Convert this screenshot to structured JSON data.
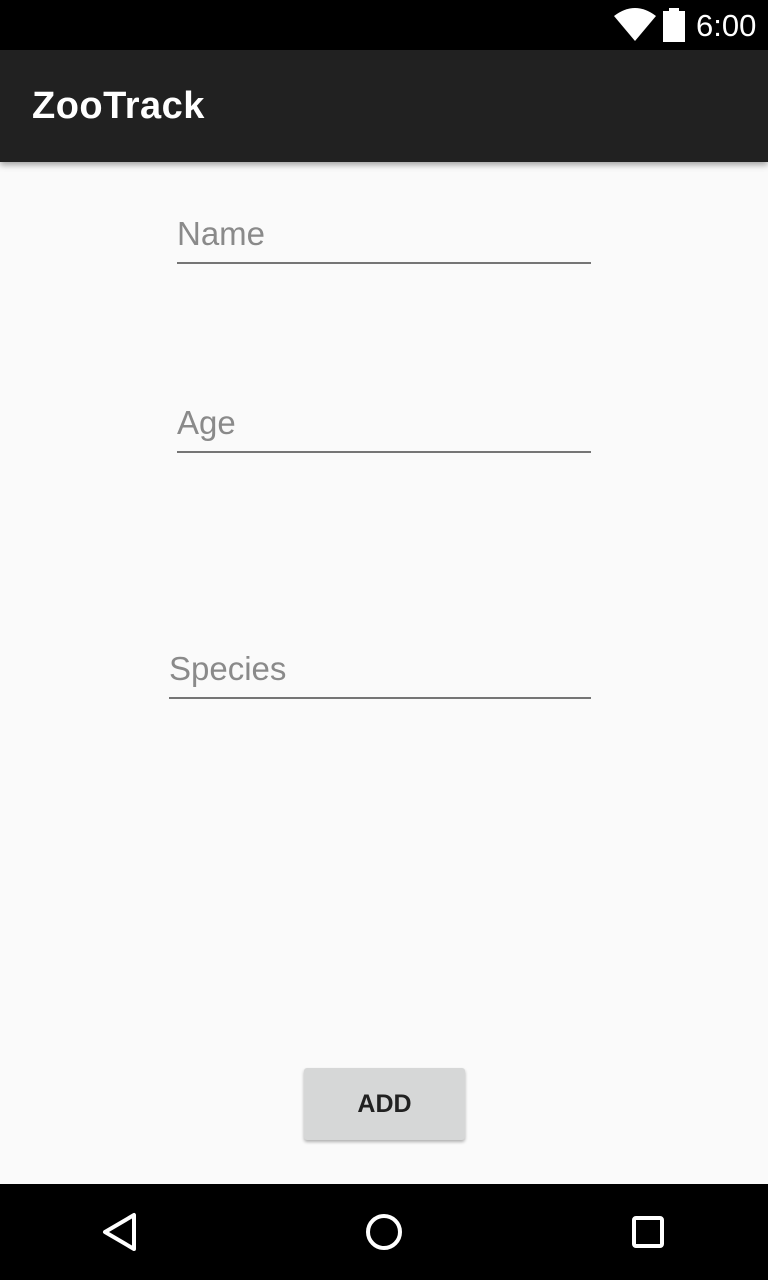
{
  "status_bar": {
    "time": "6:00",
    "icons": [
      "wifi-icon",
      "battery-icon"
    ]
  },
  "app_bar": {
    "title": "ZooTrack"
  },
  "form": {
    "name": {
      "placeholder": "Name",
      "value": ""
    },
    "age": {
      "placeholder": "Age",
      "value": ""
    },
    "species": {
      "placeholder": "Species",
      "value": ""
    },
    "add_label": "ADD"
  },
  "nav_bar": {
    "buttons": [
      "back-icon",
      "home-icon",
      "recents-icon"
    ]
  },
  "colors": {
    "status_bar": "#000000",
    "app_bar": "#212121",
    "background": "#fafafa",
    "field_underline": "#757575",
    "button": "#d6d7d7",
    "nav_bar": "#000000"
  }
}
